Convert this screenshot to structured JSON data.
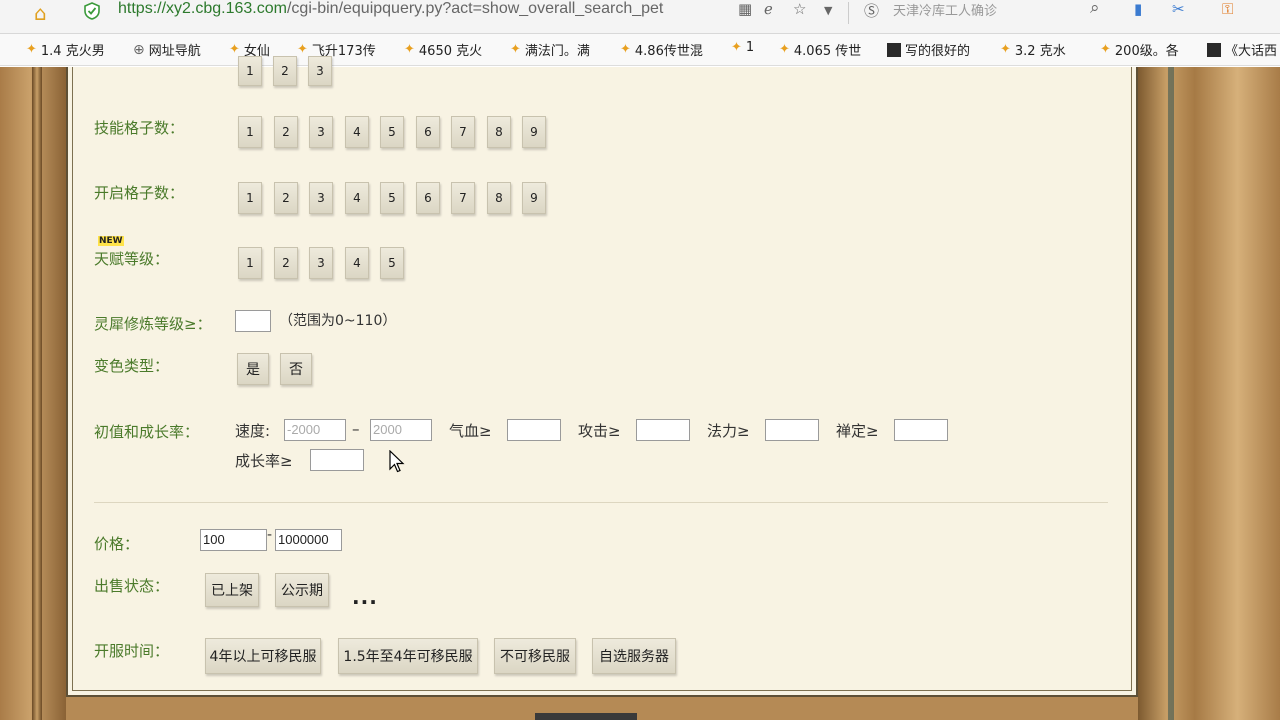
{
  "browser": {
    "url_host": "https://xy2.cbg.163.com",
    "url_path": "/cgi-bin/equipquery.py?act=show_overall_search_pet",
    "search_text": "天津冷库工人确诊",
    "bookmarks": [
      {
        "icon": "star-icon",
        "label": "1.4 克火男"
      },
      {
        "icon": "globe-icon",
        "label": "网址导航"
      },
      {
        "icon": "star-icon",
        "label": "女仙"
      },
      {
        "icon": "star-icon",
        "label": "飞升173传"
      },
      {
        "icon": "star-icon",
        "label": "4650 克火"
      },
      {
        "icon": "star-icon",
        "label": "满法门。满"
      },
      {
        "icon": "star-icon",
        "label": "4.86传世混"
      },
      {
        "icon": "star-icon",
        "label": "1"
      },
      {
        "icon": "star-icon",
        "label": "4.065 传世"
      },
      {
        "icon": "thumb-icon",
        "label": "写的很好的"
      },
      {
        "icon": "star-icon",
        "label": "3.2   克水"
      },
      {
        "icon": "star-icon",
        "label": "200级。各"
      },
      {
        "icon": "thumb-icon",
        "label": "《大话西"
      }
    ]
  },
  "form": {
    "top_row_buttons": [
      "1",
      "2",
      "3"
    ],
    "skill_slots": {
      "label": "技能格子数：",
      "options": [
        "1",
        "2",
        "3",
        "4",
        "5",
        "6",
        "7",
        "8",
        "9"
      ]
    },
    "open_slots": {
      "label": "开启格子数：",
      "options": [
        "1",
        "2",
        "3",
        "4",
        "5",
        "6",
        "7",
        "8",
        "9"
      ]
    },
    "talent_level": {
      "badge": "NEW",
      "label": "天赋等级：",
      "options": [
        "1",
        "2",
        "3",
        "4",
        "5"
      ]
    },
    "rhino_level": {
      "label": "灵犀修炼等级≥：",
      "value": "",
      "hint": "（范围为0~110）"
    },
    "color_type": {
      "label": "变色类型：",
      "options": [
        "是",
        "否"
      ]
    },
    "growth": {
      "label": "初值和成长率：",
      "speed_label": "速度:",
      "speed_min_placeholder": "-2000",
      "speed_sep": "–",
      "speed_max_placeholder": "2000",
      "hp_label": "气血≥",
      "attack_label": "攻击≥",
      "mana_label": "法力≥",
      "zen_label": "禅定≥",
      "growth_label": "成长率≥"
    },
    "price": {
      "label": "价格：",
      "min": "100",
      "sep": "-",
      "max": "1000000"
    },
    "sale_status": {
      "label": "出售状态：",
      "options": [
        "已上架",
        "公示期"
      ],
      "more": "..."
    },
    "server_time": {
      "label": "开服时间：",
      "options": [
        "4年以上可移民服",
        "1.5年至4年可移民服",
        "不可移民服",
        "自选服务器"
      ]
    }
  }
}
